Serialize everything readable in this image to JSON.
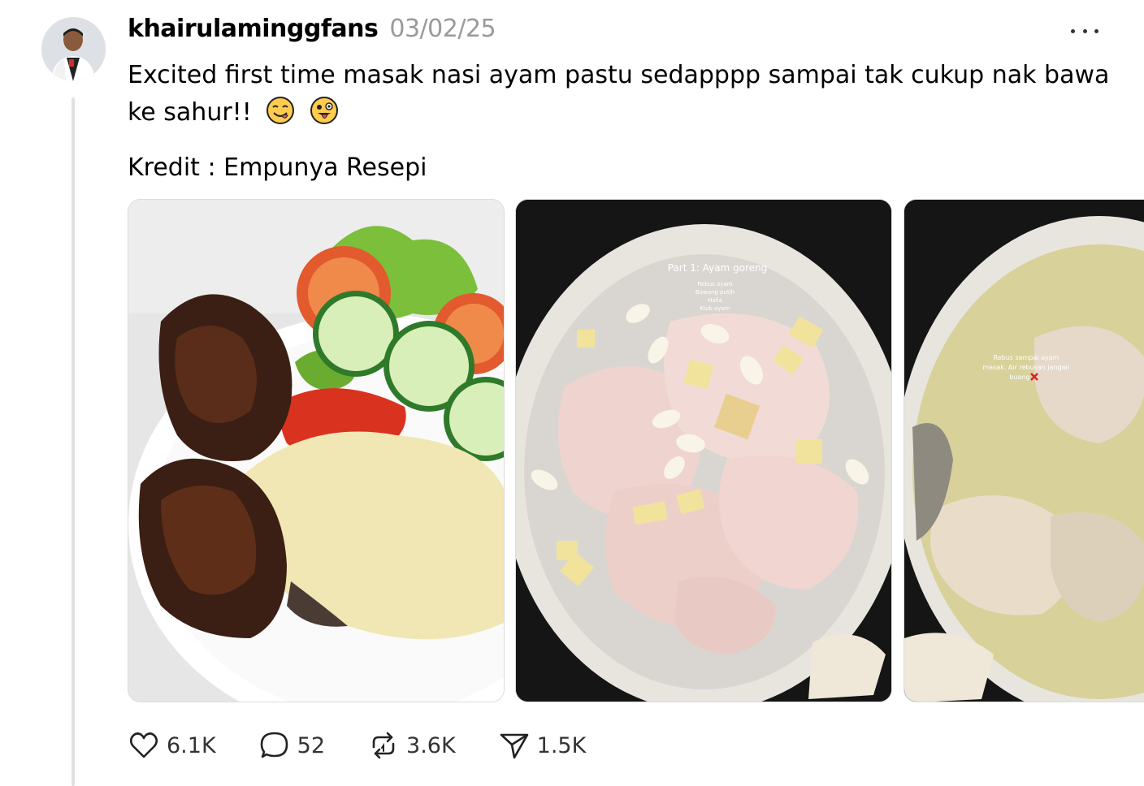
{
  "post": {
    "username": "khairulaminggfans",
    "timestamp": "03/02/25",
    "text": "Excited first time masak nasi ayam pastu sedapppp sampai tak cukup nak bawa ke sahur!!",
    "credit": "Kredit : Empunya Resepi"
  },
  "media": {
    "image2": {
      "title": "Part 1: Ayam goreng",
      "lines": [
        "Rebus ayam",
        "Bawang putih",
        "Halia",
        "Kiub ayam"
      ]
    },
    "image3": {
      "lines": [
        "Rebus sampai ayam",
        "masak. Air rebusan jangan",
        "buang"
      ]
    }
  },
  "actions": {
    "likes": "6.1K",
    "comments": "52",
    "reposts": "3.6K",
    "shares": "1.5K"
  },
  "icons": {
    "avatar": "avatar",
    "more": "more-icon",
    "like": "heart-icon",
    "comment": "comment-icon",
    "repost": "repost-icon",
    "share": "share-icon"
  },
  "colors": {
    "text": "#000000",
    "muted": "#9a9a9a",
    "thread_line": "#e1e1e1"
  }
}
